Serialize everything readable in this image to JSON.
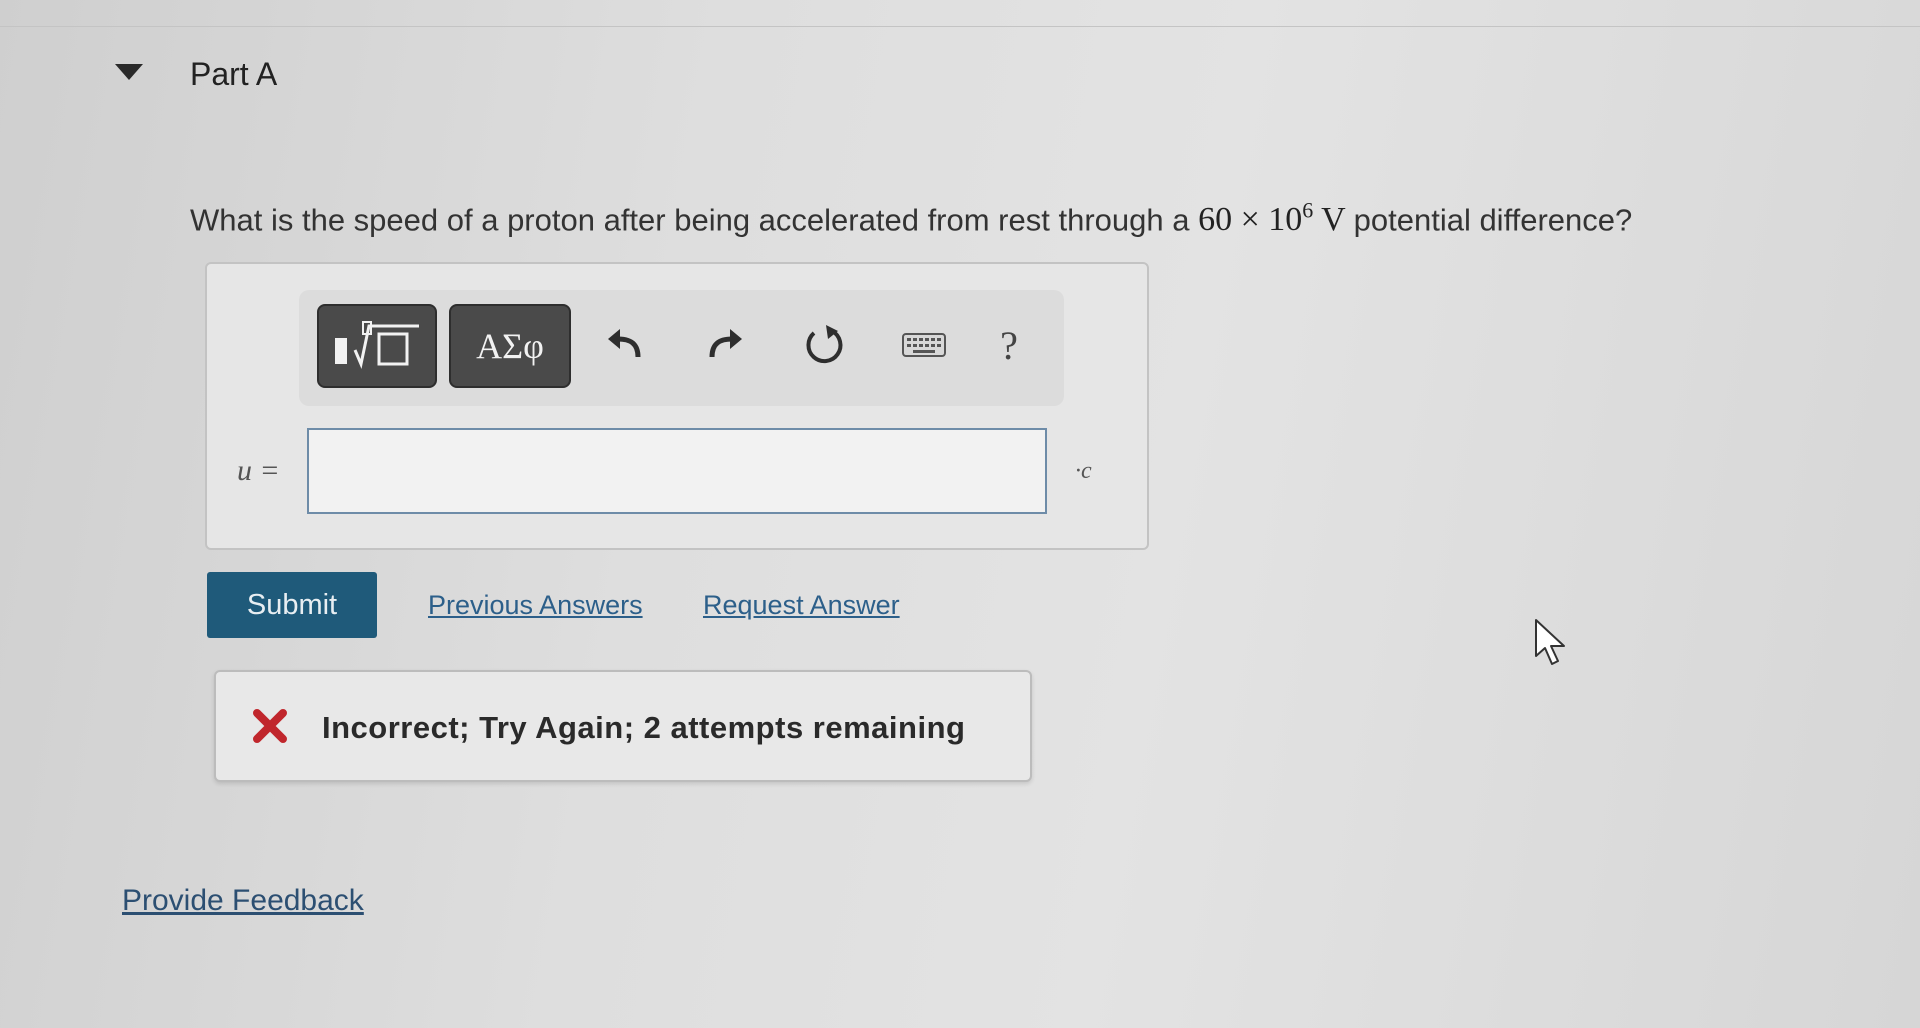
{
  "part": {
    "title": "Part A"
  },
  "question": {
    "prefix": "What is the speed of a proton after being accelerated from rest through a",
    "value": "60",
    "times": "×",
    "base": "10",
    "exponent": "6",
    "unit": "V",
    "suffix": "potential difference?"
  },
  "toolbar": {
    "templates_icon": "fraction-radical-template-icon",
    "greek_label": "ΑΣφ",
    "undo_icon": "undo-icon",
    "redo_icon": "redo-icon",
    "reset_icon": "reset-icon",
    "keyboard_icon": "keyboard-icon",
    "help_label": "?"
  },
  "answer": {
    "variable": "u =",
    "value": "",
    "unit": "·c"
  },
  "actions": {
    "submit_label": "Submit",
    "previous_answers_label": "Previous Answers",
    "request_answer_label": "Request Answer"
  },
  "feedback": {
    "message": "Incorrect; Try Again; 2 attempts remaining",
    "status_color": "#c0262c"
  },
  "footer": {
    "provide_feedback_label": "Provide Feedback"
  },
  "colors": {
    "submit_bg": "#1f5a7a",
    "link": "#2c5f8a",
    "input_border": "#6e8ca8"
  }
}
